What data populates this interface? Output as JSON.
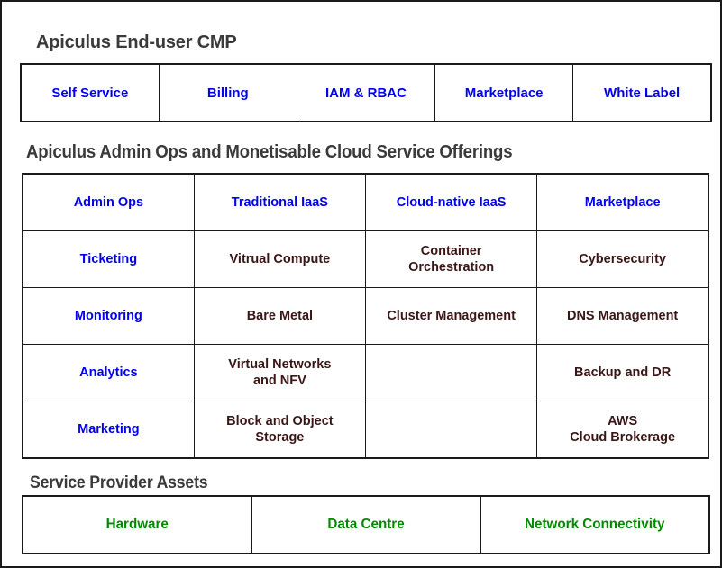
{
  "colors": {
    "heading": "#3a3a3a",
    "blue": "#0000ee",
    "maroon": "#3a1616",
    "green": "#008a00",
    "border": "#1a1a1a",
    "background": "#ffffff"
  },
  "sections": {
    "enduser": {
      "heading": "Apiculus End-user CMP",
      "items": [
        "Self Service",
        "Billing",
        "IAM & RBAC",
        "Marketplace",
        "White Label"
      ]
    },
    "admin": {
      "heading": "Apiculus Admin Ops and Monetisable Cloud Service Offerings",
      "columns": [
        "Admin Ops",
        "Traditional IaaS",
        "Cloud-native IaaS",
        "Marketplace"
      ],
      "rows": [
        {
          "admin_ops": "Ticketing",
          "traditional_iaas": "Vitrual Compute",
          "cloud_native_iaas_line1": "Container",
          "cloud_native_iaas_line2": "Orchestration",
          "marketplace_line1": "Cybersecurity",
          "marketplace_line2": ""
        },
        {
          "admin_ops": "Monitoring",
          "traditional_iaas": "Bare Metal",
          "cloud_native_iaas_line1": "Cluster Management",
          "cloud_native_iaas_line2": "",
          "marketplace_line1": "DNS Management",
          "marketplace_line2": ""
        },
        {
          "admin_ops": "Analytics",
          "traditional_iaas_line1": "Virtual Networks",
          "traditional_iaas_line2": "and NFV",
          "cloud_native_iaas_line1": "",
          "cloud_native_iaas_line2": "",
          "marketplace_line1": "Backup and DR",
          "marketplace_line2": ""
        },
        {
          "admin_ops": "Marketing",
          "traditional_iaas_line1": "Block and Object",
          "traditional_iaas_line2": "Storage",
          "cloud_native_iaas_line1": "",
          "cloud_native_iaas_line2": "",
          "marketplace_line1": "AWS",
          "marketplace_line2": "Cloud Brokerage"
        }
      ]
    },
    "assets": {
      "heading": "Service Provider Assets",
      "items": [
        "Hardware",
        "Data Centre",
        "Network Connectivity"
      ]
    }
  }
}
